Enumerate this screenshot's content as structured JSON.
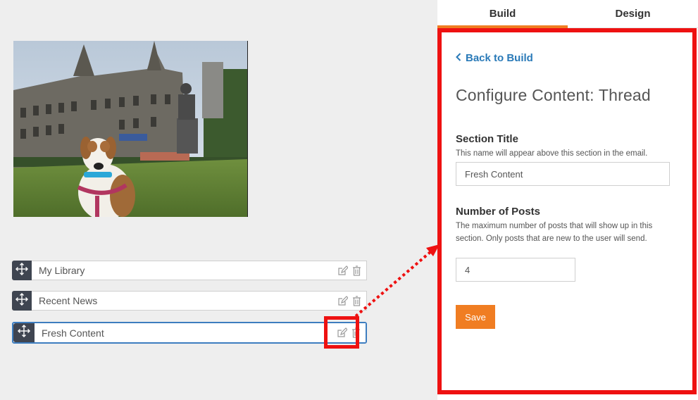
{
  "canvas": {
    "blocks": [
      {
        "label": "My Library"
      },
      {
        "label": "Recent News"
      },
      {
        "label": "Fresh Content"
      }
    ]
  },
  "panel": {
    "tabs": [
      {
        "label": "Build",
        "active": true
      },
      {
        "label": "Design",
        "active": false
      }
    ],
    "back_label": "Back to Build",
    "heading": "Configure Content: Thread",
    "section_title": {
      "label": "Section Title",
      "help": "This name will appear above this section in the email.",
      "value": "Fresh Content"
    },
    "num_posts": {
      "label": "Number of Posts",
      "help": "The maximum number of posts that will show up in this section. Only posts that are new to the user will send.",
      "value": "4"
    },
    "save_label": "Save"
  },
  "colors": {
    "accent": "#f07d22",
    "link": "#2a7ab8",
    "highlight": "#ee1111",
    "drag_handle": "#3f4551",
    "selected_border": "#3d7dbf"
  },
  "icons": [
    "move-icon",
    "edit-icon",
    "trash-icon",
    "chevron-left-icon"
  ]
}
